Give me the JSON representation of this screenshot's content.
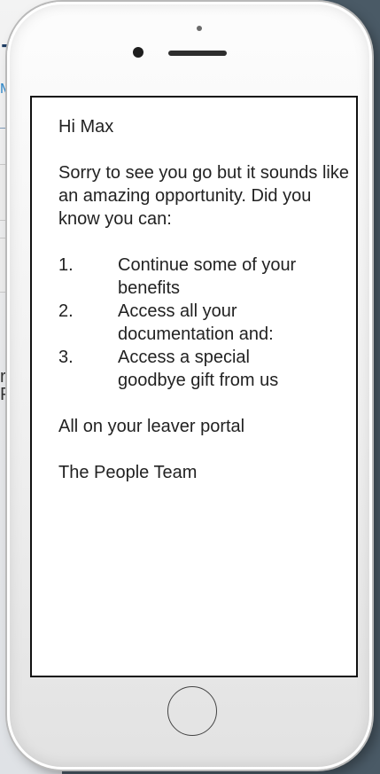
{
  "background": {
    "title_fragment": "T",
    "subtitle_fragment": "M",
    "text_fragment_1": "r",
    "text_fragment_2": "P"
  },
  "message": {
    "greeting": "Hi Max",
    "intro": "Sorry to see you go but it sounds like an amazing opportunity. Did you know you can:",
    "items": [
      {
        "number": "1.",
        "text": "Continue some of your benefits"
      },
      {
        "number": "2.",
        "text": "Access all your documentation and:"
      },
      {
        "number": "3.",
        "text": "Access a special goodbye gift from us"
      }
    ],
    "portal_line": "All on your leaver portal",
    "signature": "The People  Team"
  },
  "colors": {
    "backdrop": "#4a5a66",
    "phone_body": "#f0f0f0",
    "screen": "#ffffff",
    "bg_title": "#1f3d63",
    "bg_subtitle": "#2c86c9"
  }
}
